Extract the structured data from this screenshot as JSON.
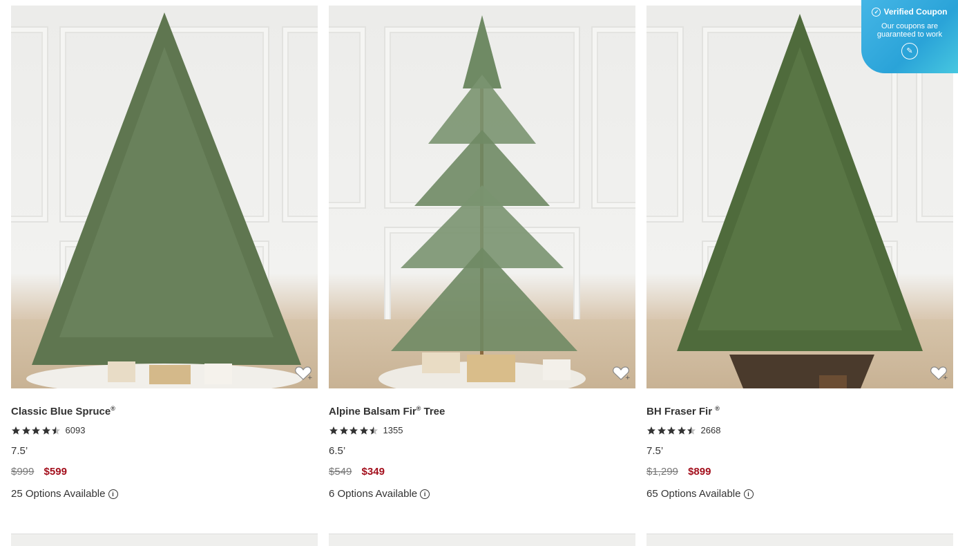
{
  "products": [
    {
      "name": "Classic Blue Spruce",
      "mark": "®",
      "suffix": "",
      "rating": 4.5,
      "reviews": "6093",
      "size": "7.5’",
      "old_price": "$999",
      "price": "$599",
      "options": "25 Options Available"
    },
    {
      "name": "Alpine Balsam Fir",
      "mark": "®",
      "suffix": " Tree",
      "rating": 4.5,
      "reviews": "1355",
      "size": "6.5’",
      "old_price": "$549",
      "price": "$349",
      "options": "6 Options Available"
    },
    {
      "name": "BH Fraser Fir ",
      "mark": "®",
      "suffix": "",
      "rating": 4.5,
      "reviews": "2668",
      "size": "7.5’",
      "old_price": "$1,299",
      "price": "$899",
      "options": "65 Options Available"
    }
  ],
  "icons": {
    "wishlist": "heart-plus-icon",
    "info": "info-icon",
    "star": "star-icon",
    "chat": "chat-icon",
    "check": "check-circle-icon"
  },
  "coupon": {
    "title": "Verified Coupon",
    "subtitle": "Our coupons are guaranteed to work"
  },
  "colors": {
    "sale_price": "#a30f1c",
    "coupon_bg": "#2aa3d8"
  }
}
